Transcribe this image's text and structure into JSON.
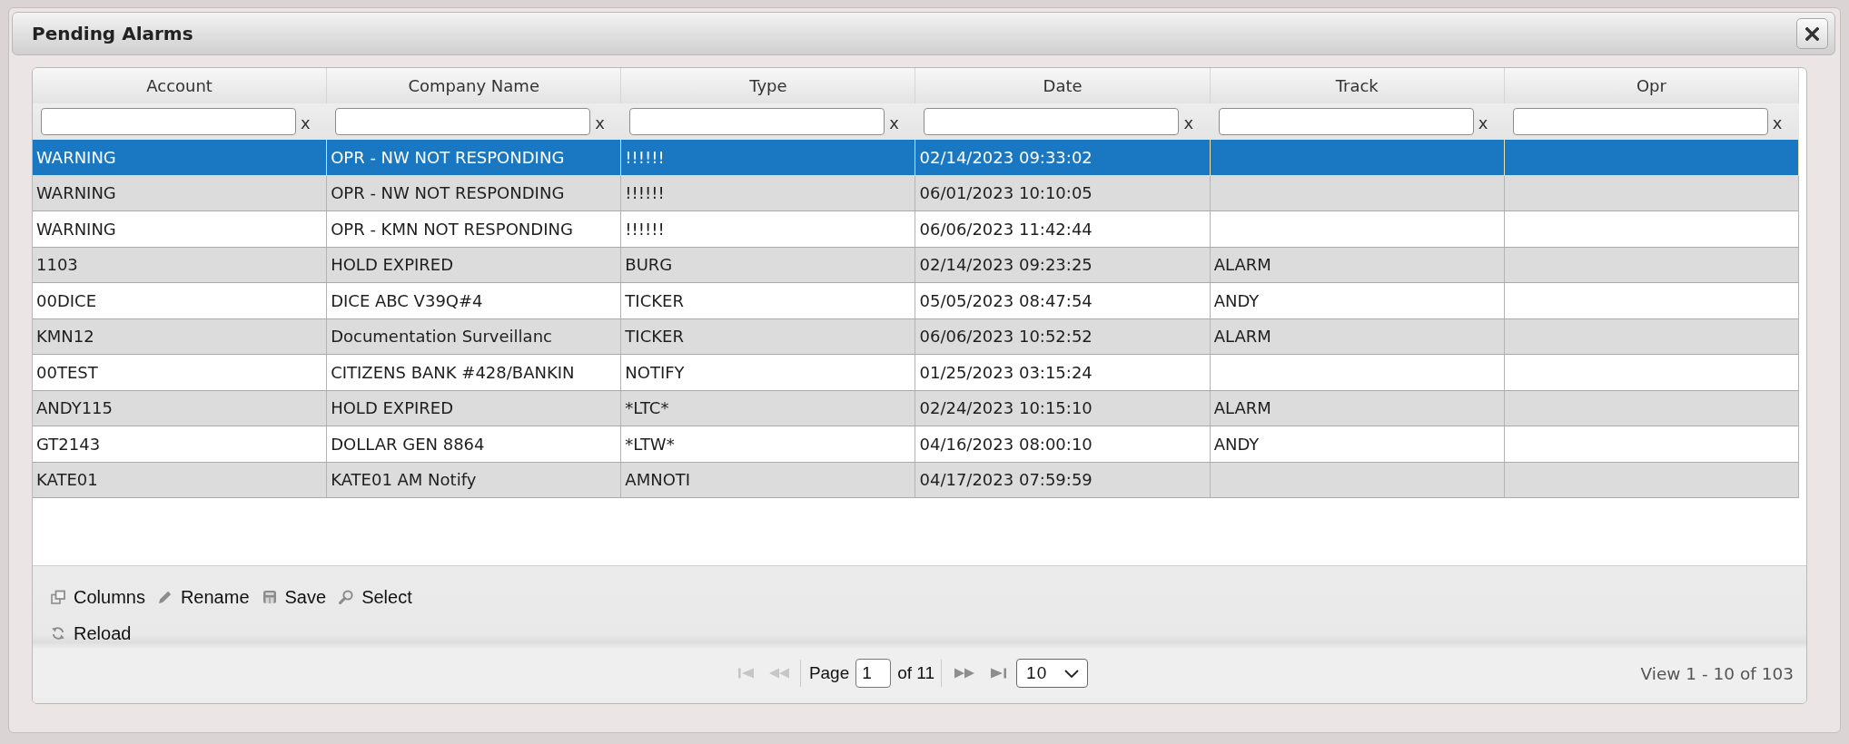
{
  "dialog": {
    "title": "Pending Alarms"
  },
  "grid": {
    "columns": [
      {
        "title": "Account",
        "filter_clear": "x"
      },
      {
        "title": "Company Name",
        "filter_clear": "x"
      },
      {
        "title": "Type",
        "filter_clear": "x"
      },
      {
        "title": "Date",
        "filter_clear": "x"
      },
      {
        "title": "Track",
        "filter_clear": "x"
      },
      {
        "title": "Opr",
        "filter_clear": "x"
      }
    ],
    "rows": [
      {
        "selected": true,
        "account": "WARNING",
        "company_name": "OPR - NW NOT RESPONDING",
        "type": "!!!!!!",
        "date": "02/14/2023 09:33:02"
      },
      {
        "selected": false,
        "account": "WARNING",
        "company_name": "OPR - NW NOT RESPONDING",
        "type": "!!!!!!",
        "date": "06/01/2023 10:10:05"
      },
      {
        "selected": false,
        "account": "WARNING",
        "company_name": "OPR - KMN NOT RESPONDING",
        "type": "!!!!!!",
        "date": "06/06/2023 11:42:44"
      },
      {
        "selected": false,
        "account": "1103",
        "company_name": "HOLD EXPIRED",
        "type": "BURG",
        "date": "02/14/2023 09:23:25",
        "track": "ALARM"
      },
      {
        "selected": false,
        "account": "00DICE",
        "company_name": "DICE ABC V39Q#4",
        "type": "TICKER",
        "date": "05/05/2023 08:47:54",
        "track": "ANDY"
      },
      {
        "selected": false,
        "account": "KMN12",
        "company_name": "Documentation Surveillanc",
        "type": "TICKER",
        "date": "06/06/2023 10:52:52",
        "track": "ALARM"
      },
      {
        "selected": false,
        "account": "00TEST",
        "company_name": "CITIZENS BANK #428/BANKIN",
        "type": "NOTIFY",
        "date": "01/25/2023 03:15:24"
      },
      {
        "selected": false,
        "account": "ANDY115",
        "company_name": "HOLD EXPIRED",
        "type": "*LTC*",
        "date": "02/24/2023 10:15:10",
        "track": "ALARM"
      },
      {
        "selected": false,
        "account": "GT2143",
        "company_name": "DOLLAR GEN 8864",
        "type": "*LTW*",
        "date": "04/16/2023 08:00:10",
        "track": "ANDY"
      },
      {
        "selected": false,
        "account": "KATE01",
        "company_name": "KATE01 AM Notify",
        "type": "AMNOTI",
        "date": "04/17/2023 07:59:59"
      }
    ]
  },
  "toolbar": {
    "lines": [
      [
        {
          "kind": "columns",
          "label": "Columns"
        },
        {
          "kind": "rename",
          "label": "Rename"
        },
        {
          "kind": "save",
          "label": "Save"
        },
        {
          "kind": "select",
          "label": "Select"
        }
      ],
      [
        {
          "kind": "reload",
          "label": "Reload"
        }
      ]
    ]
  },
  "pager": {
    "back_buttons": [
      {
        "kind": "first",
        "disabled": true
      },
      {
        "kind": "prev",
        "disabled": true
      }
    ],
    "page_label": "Page",
    "page_value": "1",
    "page_count_label": "of 11",
    "forward_buttons": [
      {
        "kind": "next",
        "disabled": false
      },
      {
        "kind": "last",
        "disabled": false
      }
    ],
    "page_size": "10",
    "summary": "View 1 - 10 of 103"
  }
}
